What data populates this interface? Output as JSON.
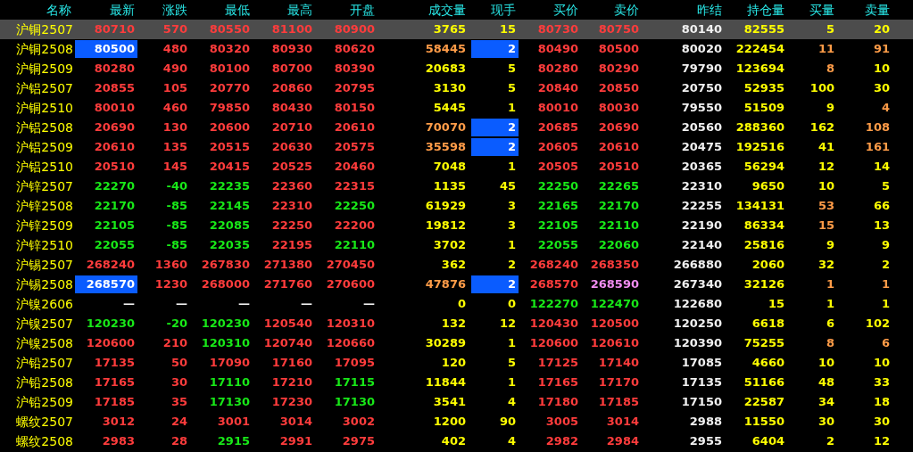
{
  "columns": [
    "名称",
    "最新",
    "涨跌",
    "最低",
    "最高",
    "开盘",
    "成交量",
    "现手",
    "买价",
    "卖价",
    "昨结",
    "持仓量",
    "买量",
    "卖量"
  ],
  "rows": [
    {
      "name": "沪铜2507",
      "last": "80710",
      "change": "570",
      "low": "80550",
      "high": "81100",
      "open": "80900",
      "volume": "3765",
      "hand": "15",
      "bid": "80730",
      "ask": "80750",
      "prev": "80140",
      "oi": "82555",
      "bid_qty": "5",
      "ask_qty": "20",
      "selected": true,
      "traded": false,
      "last_flash": false,
      "ask_flash": false,
      "bid_qty_changed": false,
      "ask_qty_changed": false
    },
    {
      "name": "沪铜2508",
      "last": "80500",
      "change": "480",
      "low": "80320",
      "high": "80930",
      "open": "80620",
      "volume": "58445",
      "hand": "2",
      "bid": "80490",
      "ask": "80500",
      "prev": "80020",
      "oi": "222454",
      "bid_qty": "11",
      "ask_qty": "91",
      "selected": false,
      "traded": true,
      "last_flash": true,
      "ask_flash": false,
      "bid_qty_changed": true,
      "ask_qty_changed": true
    },
    {
      "name": "沪铜2509",
      "last": "80280",
      "change": "490",
      "low": "80100",
      "high": "80700",
      "open": "80390",
      "volume": "20683",
      "hand": "5",
      "bid": "80280",
      "ask": "80290",
      "prev": "79790",
      "oi": "123694",
      "bid_qty": "8",
      "ask_qty": "10",
      "selected": false,
      "traded": false,
      "last_flash": false,
      "ask_flash": false,
      "bid_qty_changed": true,
      "ask_qty_changed": false
    },
    {
      "name": "沪铝2507",
      "last": "20855",
      "change": "105",
      "low": "20770",
      "high": "20860",
      "open": "20795",
      "volume": "3130",
      "hand": "5",
      "bid": "20840",
      "ask": "20850",
      "prev": "20750",
      "oi": "52935",
      "bid_qty": "100",
      "ask_qty": "30",
      "selected": false,
      "traded": false,
      "last_flash": false,
      "ask_flash": false,
      "bid_qty_changed": false,
      "ask_qty_changed": false
    },
    {
      "name": "沪铜2510",
      "last": "80010",
      "change": "460",
      "low": "79850",
      "high": "80430",
      "open": "80150",
      "volume": "5445",
      "hand": "1",
      "bid": "80010",
      "ask": "80030",
      "prev": "79550",
      "oi": "51509",
      "bid_qty": "9",
      "ask_qty": "4",
      "selected": false,
      "traded": false,
      "last_flash": false,
      "ask_flash": false,
      "bid_qty_changed": false,
      "ask_qty_changed": true
    },
    {
      "name": "沪铝2508",
      "last": "20690",
      "change": "130",
      "low": "20600",
      "high": "20710",
      "open": "20610",
      "volume": "70070",
      "hand": "2",
      "bid": "20685",
      "ask": "20690",
      "prev": "20560",
      "oi": "288360",
      "bid_qty": "162",
      "ask_qty": "108",
      "selected": false,
      "traded": true,
      "last_flash": false,
      "ask_flash": false,
      "bid_qty_changed": false,
      "ask_qty_changed": true
    },
    {
      "name": "沪铝2509",
      "last": "20610",
      "change": "135",
      "low": "20515",
      "high": "20630",
      "open": "20575",
      "volume": "35598",
      "hand": "2",
      "bid": "20605",
      "ask": "20610",
      "prev": "20475",
      "oi": "192516",
      "bid_qty": "41",
      "ask_qty": "161",
      "selected": false,
      "traded": true,
      "last_flash": false,
      "ask_flash": false,
      "bid_qty_changed": false,
      "ask_qty_changed": true
    },
    {
      "name": "沪铝2510",
      "last": "20510",
      "change": "145",
      "low": "20415",
      "high": "20525",
      "open": "20460",
      "volume": "7048",
      "hand": "1",
      "bid": "20505",
      "ask": "20510",
      "prev": "20365",
      "oi": "56294",
      "bid_qty": "12",
      "ask_qty": "14",
      "selected": false,
      "traded": false,
      "last_flash": false,
      "ask_flash": false,
      "bid_qty_changed": false,
      "ask_qty_changed": false
    },
    {
      "name": "沪锌2507",
      "last": "22270",
      "change": "-40",
      "low": "22235",
      "high": "22360",
      "open": "22315",
      "volume": "1135",
      "hand": "45",
      "bid": "22250",
      "ask": "22265",
      "prev": "22310",
      "oi": "9650",
      "bid_qty": "10",
      "ask_qty": "5",
      "selected": false,
      "traded": false,
      "last_flash": false,
      "ask_flash": false,
      "bid_qty_changed": false,
      "ask_qty_changed": false
    },
    {
      "name": "沪锌2508",
      "last": "22170",
      "change": "-85",
      "low": "22145",
      "high": "22310",
      "open": "22250",
      "volume": "61929",
      "hand": "3",
      "bid": "22165",
      "ask": "22170",
      "prev": "22255",
      "oi": "134131",
      "bid_qty": "53",
      "ask_qty": "66",
      "selected": false,
      "traded": false,
      "last_flash": false,
      "ask_flash": false,
      "bid_qty_changed": true,
      "ask_qty_changed": false
    },
    {
      "name": "沪锌2509",
      "last": "22105",
      "change": "-85",
      "low": "22085",
      "high": "22250",
      "open": "22200",
      "volume": "19812",
      "hand": "3",
      "bid": "22105",
      "ask": "22110",
      "prev": "22190",
      "oi": "86334",
      "bid_qty": "15",
      "ask_qty": "13",
      "selected": false,
      "traded": false,
      "last_flash": false,
      "ask_flash": false,
      "bid_qty_changed": true,
      "ask_qty_changed": false
    },
    {
      "name": "沪锌2510",
      "last": "22055",
      "change": "-85",
      "low": "22035",
      "high": "22195",
      "open": "22110",
      "volume": "3702",
      "hand": "1",
      "bid": "22055",
      "ask": "22060",
      "prev": "22140",
      "oi": "25816",
      "bid_qty": "9",
      "ask_qty": "9",
      "selected": false,
      "traded": false,
      "last_flash": false,
      "ask_flash": false,
      "bid_qty_changed": false,
      "ask_qty_changed": false
    },
    {
      "name": "沪锡2507",
      "last": "268240",
      "change": "1360",
      "low": "267830",
      "high": "271380",
      "open": "270450",
      "volume": "362",
      "hand": "2",
      "bid": "268240",
      "ask": "268350",
      "prev": "266880",
      "oi": "2060",
      "bid_qty": "32",
      "ask_qty": "2",
      "selected": false,
      "traded": false,
      "last_flash": false,
      "ask_flash": false,
      "bid_qty_changed": false,
      "ask_qty_changed": false
    },
    {
      "name": "沪锡2508",
      "last": "268570",
      "change": "1230",
      "low": "268000",
      "high": "271760",
      "open": "270600",
      "volume": "47876",
      "hand": "2",
      "bid": "268570",
      "ask": "268590",
      "prev": "267340",
      "oi": "32126",
      "bid_qty": "1",
      "ask_qty": "1",
      "selected": false,
      "traded": true,
      "last_flash": true,
      "ask_flash": true,
      "bid_qty_changed": true,
      "ask_qty_changed": true
    },
    {
      "name": "沪镍2606",
      "last": "—",
      "change": "—",
      "low": "—",
      "high": "—",
      "open": "—",
      "volume": "0",
      "hand": "0",
      "bid": "122270",
      "ask": "122470",
      "prev": "122680",
      "oi": "15",
      "bid_qty": "1",
      "ask_qty": "1",
      "selected": false,
      "traded": false,
      "last_flash": false,
      "ask_flash": false,
      "bid_qty_changed": false,
      "ask_qty_changed": false
    },
    {
      "name": "沪镍2507",
      "last": "120230",
      "change": "-20",
      "low": "120230",
      "high": "120540",
      "open": "120310",
      "volume": "132",
      "hand": "12",
      "bid": "120430",
      "ask": "120500",
      "prev": "120250",
      "oi": "6618",
      "bid_qty": "6",
      "ask_qty": "102",
      "selected": false,
      "traded": false,
      "last_flash": false,
      "ask_flash": false,
      "bid_qty_changed": false,
      "ask_qty_changed": false
    },
    {
      "name": "沪镍2508",
      "last": "120600",
      "change": "210",
      "low": "120310",
      "high": "120740",
      "open": "120660",
      "volume": "30289",
      "hand": "1",
      "bid": "120600",
      "ask": "120610",
      "prev": "120390",
      "oi": "75255",
      "bid_qty": "8",
      "ask_qty": "6",
      "selected": false,
      "traded": false,
      "last_flash": false,
      "ask_flash": false,
      "bid_qty_changed": true,
      "ask_qty_changed": true
    },
    {
      "name": "沪铅2507",
      "last": "17135",
      "change": "50",
      "low": "17090",
      "high": "17160",
      "open": "17095",
      "volume": "120",
      "hand": "5",
      "bid": "17125",
      "ask": "17140",
      "prev": "17085",
      "oi": "4660",
      "bid_qty": "10",
      "ask_qty": "10",
      "selected": false,
      "traded": false,
      "last_flash": false,
      "ask_flash": false,
      "bid_qty_changed": false,
      "ask_qty_changed": false
    },
    {
      "name": "沪铅2508",
      "last": "17165",
      "change": "30",
      "low": "17110",
      "high": "17210",
      "open": "17115",
      "volume": "11844",
      "hand": "1",
      "bid": "17165",
      "ask": "17170",
      "prev": "17135",
      "oi": "51166",
      "bid_qty": "48",
      "ask_qty": "33",
      "selected": false,
      "traded": false,
      "last_flash": false,
      "ask_flash": false,
      "bid_qty_changed": false,
      "ask_qty_changed": false
    },
    {
      "name": "沪铅2509",
      "last": "17185",
      "change": "35",
      "low": "17130",
      "high": "17230",
      "open": "17130",
      "volume": "3541",
      "hand": "4",
      "bid": "17180",
      "ask": "17185",
      "prev": "17150",
      "oi": "22587",
      "bid_qty": "34",
      "ask_qty": "18",
      "selected": false,
      "traded": false,
      "last_flash": false,
      "ask_flash": false,
      "bid_qty_changed": false,
      "ask_qty_changed": false
    },
    {
      "name": "螺纹2507",
      "last": "3012",
      "change": "24",
      "low": "3001",
      "high": "3014",
      "open": "3002",
      "volume": "1200",
      "hand": "90",
      "bid": "3005",
      "ask": "3014",
      "prev": "2988",
      "oi": "11550",
      "bid_qty": "30",
      "ask_qty": "30",
      "selected": false,
      "traded": false,
      "last_flash": false,
      "ask_flash": false,
      "bid_qty_changed": false,
      "ask_qty_changed": false
    },
    {
      "name": "螺纹2508",
      "last": "2983",
      "change": "28",
      "low": "2915",
      "high": "2991",
      "open": "2975",
      "volume": "402",
      "hand": "4",
      "bid": "2982",
      "ask": "2984",
      "prev": "2955",
      "oi": "6404",
      "bid_qty": "2",
      "ask_qty": "12",
      "selected": false,
      "traded": false,
      "last_flash": false,
      "ask_flash": false,
      "bid_qty_changed": false,
      "ask_qty_changed": false
    }
  ]
}
